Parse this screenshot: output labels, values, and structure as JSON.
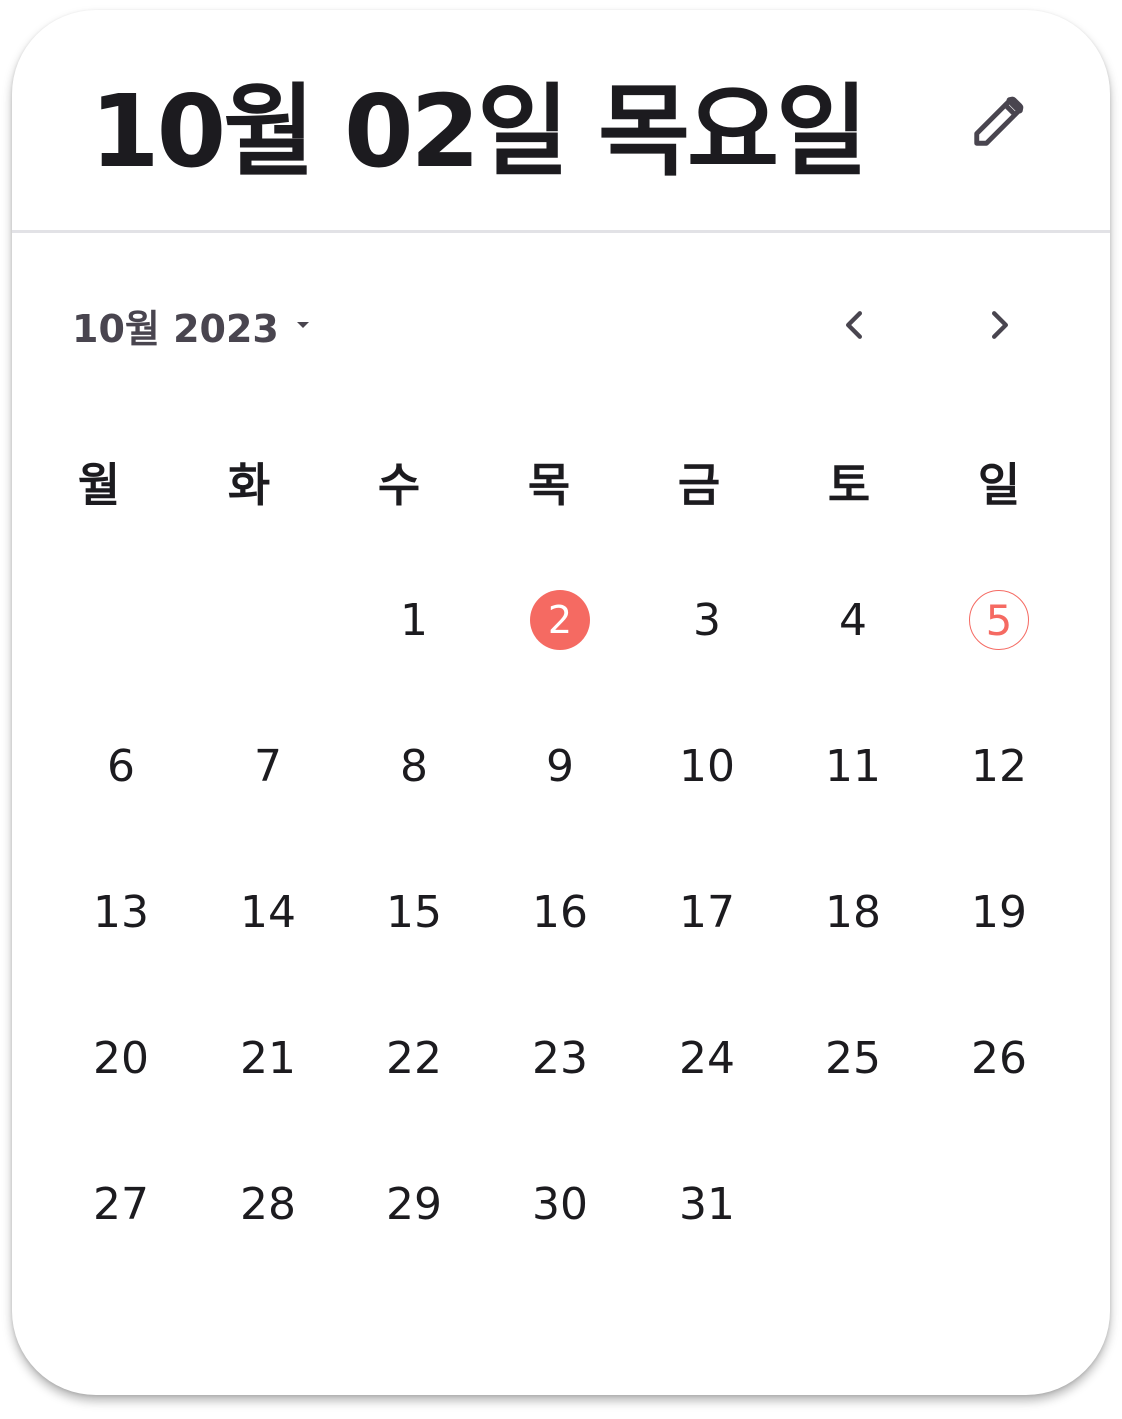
{
  "header": {
    "title": "10월 02일 목요일",
    "edit_icon": "pencil-icon"
  },
  "month_selector": {
    "label": "10월 2023",
    "dropdown_icon": "arrow-drop-down-icon",
    "prev_icon": "chevron-left-icon",
    "next_icon": "chevron-right-icon"
  },
  "weekdays": [
    "월",
    "화",
    "수",
    "목",
    "금",
    "토",
    "일"
  ],
  "weeks": [
    [
      "",
      "",
      "1",
      "2",
      "3",
      "4",
      "5"
    ],
    [
      "6",
      "7",
      "8",
      "9",
      "10",
      "11",
      "12"
    ],
    [
      "13",
      "14",
      "15",
      "16",
      "17",
      "18",
      "19"
    ],
    [
      "20",
      "21",
      "22",
      "23",
      "24",
      "25",
      "26"
    ],
    [
      "27",
      "28",
      "29",
      "30",
      "31",
      "",
      ""
    ]
  ],
  "selected_day": "2",
  "today": "5",
  "colors": {
    "accent": "#f56a62",
    "text": "#1c1b1f",
    "muted": "#49454f",
    "divider": "#e2e2e6"
  }
}
